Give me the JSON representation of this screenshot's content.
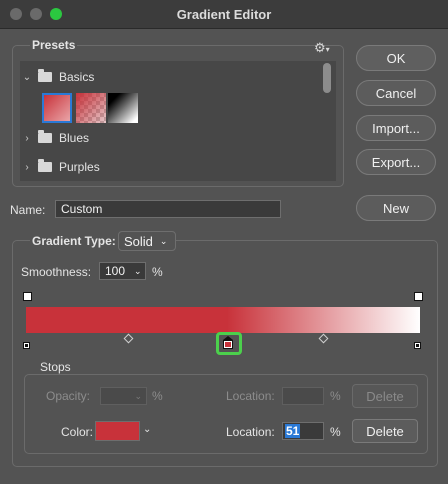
{
  "window": {
    "title": "Gradient Editor"
  },
  "presets": {
    "label": "Presets",
    "folders": [
      {
        "name": "Basics",
        "expanded": true
      },
      {
        "name": "Blues",
        "expanded": false
      },
      {
        "name": "Purples",
        "expanded": false
      }
    ],
    "gear_icon": "gear-icon"
  },
  "buttons": {
    "ok": "OK",
    "cancel": "Cancel",
    "import": "Import...",
    "export": "Export...",
    "new": "New"
  },
  "name": {
    "label": "Name:",
    "value": "Custom"
  },
  "gradient_type": {
    "label": "Gradient Type:",
    "value": "Solid"
  },
  "smoothness": {
    "label": "Smoothness:",
    "value": "100",
    "unit": "%"
  },
  "gradient": {
    "start_color": "#c8323a",
    "end_color": "#ffffff",
    "midpoint_color_location": 51
  },
  "stops": {
    "label": "Stops",
    "opacity_label": "Opacity:",
    "opacity_value": "",
    "opacity_unit": "%",
    "location_top_label": "Location:",
    "location_top_value": "",
    "location_top_unit": "%",
    "delete_top": "Delete",
    "color_label": "Color:",
    "color_value": "#c8323a",
    "location_label": "Location:",
    "location_value": "51",
    "location_unit": "%",
    "delete": "Delete"
  },
  "colors": {
    "accent": "#2a79d6",
    "highlight": "#4cd04c",
    "stop_red": "#c8323a"
  }
}
